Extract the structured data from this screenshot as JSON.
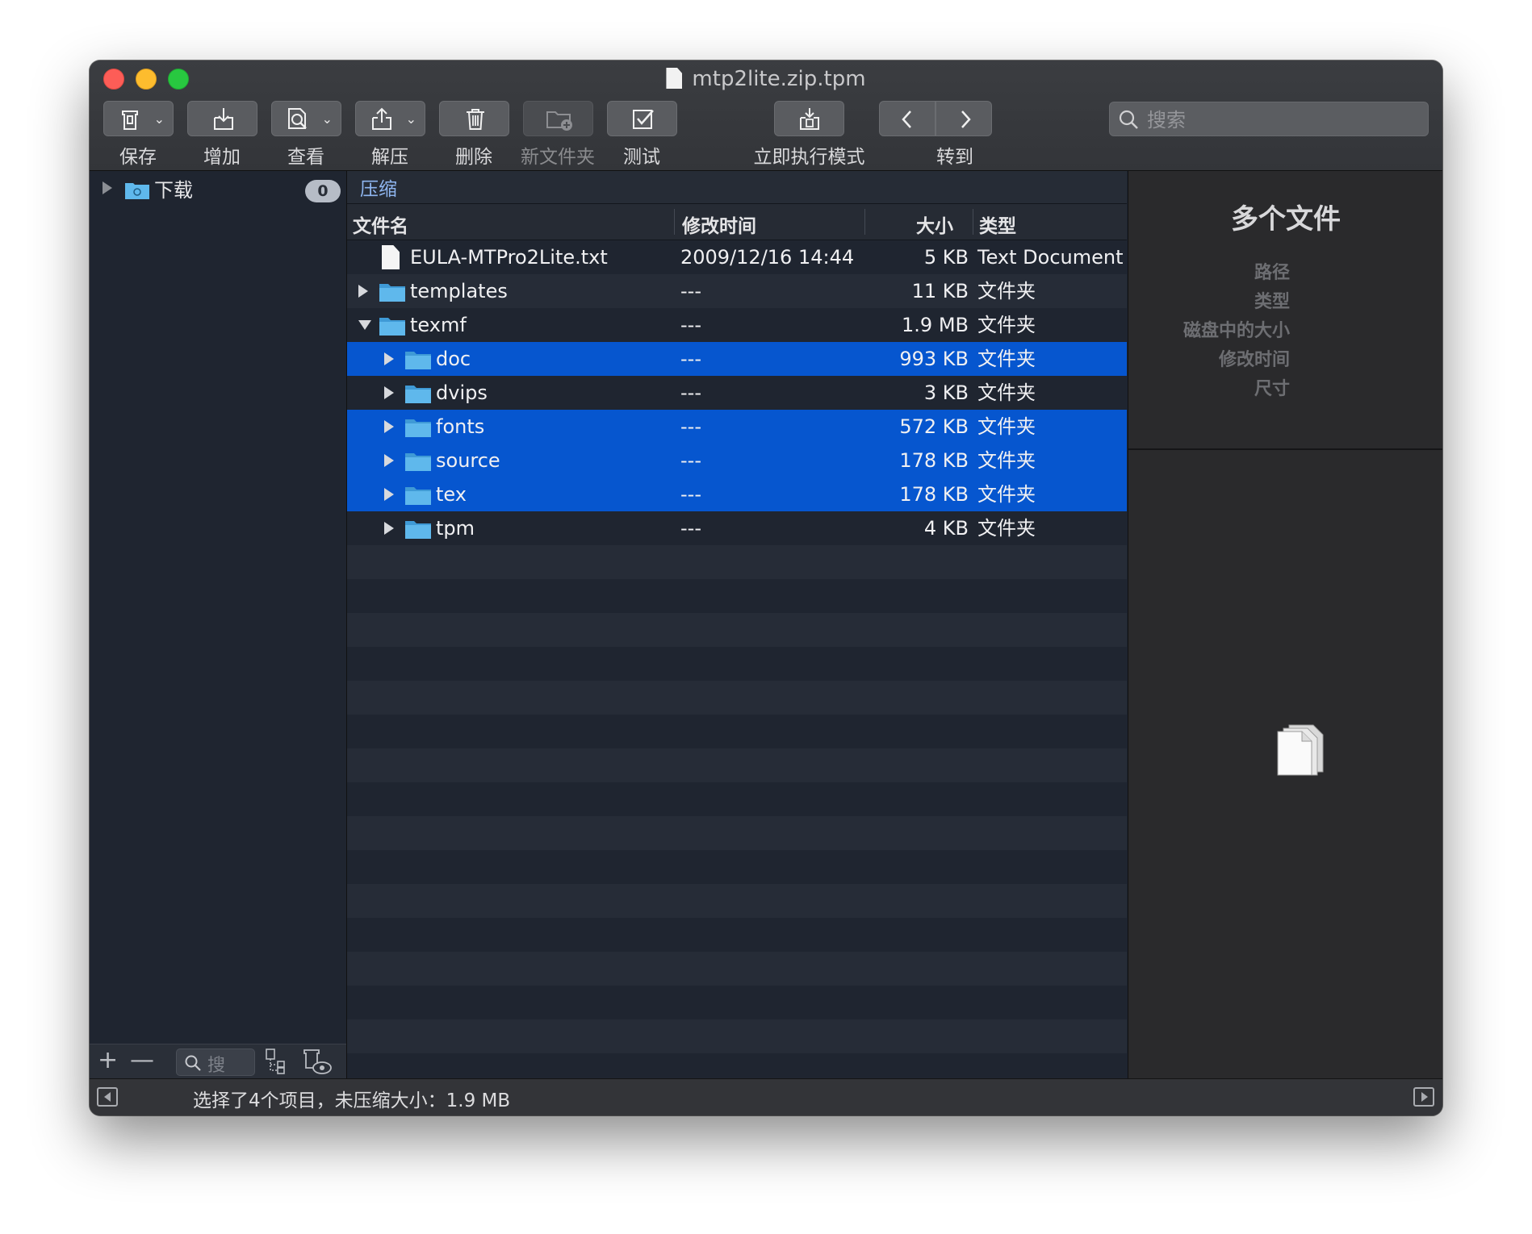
{
  "window": {
    "title": "mtp2lite.zip.tpm"
  },
  "toolbar": {
    "save": "保存",
    "add": "增加",
    "view": "查看",
    "extract": "解压",
    "delete": "删除",
    "new_folder": "新文件夹",
    "test": "测试",
    "instant_mode": "立即执行模式",
    "goto": "转到",
    "search_placeholder": "搜索"
  },
  "sidebar": {
    "items": [
      {
        "label": "下载",
        "badge": "0"
      }
    ],
    "search_placeholder": "搜"
  },
  "pathbar": {
    "label": "压缩"
  },
  "columns": {
    "name": "文件名",
    "modified": "修改时间",
    "size": "大小",
    "type": "类型"
  },
  "files": [
    {
      "name": "EULA-MTPro2Lite.txt",
      "date": "2009/12/16 14:44",
      "size": "5 KB",
      "type": "Text Document",
      "kind": "file",
      "level": 0,
      "selected": false
    },
    {
      "name": "templates",
      "date": "---",
      "size": "11 KB",
      "type": "文件夹",
      "kind": "folder",
      "level": 0,
      "expanded": false,
      "selected": false
    },
    {
      "name": "texmf",
      "date": "---",
      "size": "1.9 MB",
      "type": "文件夹",
      "kind": "folder",
      "level": 0,
      "expanded": true,
      "selected": false
    },
    {
      "name": "doc",
      "date": "---",
      "size": "993 KB",
      "type": "文件夹",
      "kind": "folder",
      "level": 1,
      "expanded": false,
      "selected": true
    },
    {
      "name": "dvips",
      "date": "---",
      "size": "3 KB",
      "type": "文件夹",
      "kind": "folder",
      "level": 1,
      "expanded": false,
      "selected": false
    },
    {
      "name": "fonts",
      "date": "---",
      "size": "572 KB",
      "type": "文件夹",
      "kind": "folder",
      "level": 1,
      "expanded": false,
      "selected": true
    },
    {
      "name": "source",
      "date": "---",
      "size": "178 KB",
      "type": "文件夹",
      "kind": "folder",
      "level": 1,
      "expanded": false,
      "selected": true
    },
    {
      "name": "tex",
      "date": "---",
      "size": "178 KB",
      "type": "文件夹",
      "kind": "folder",
      "level": 1,
      "expanded": false,
      "selected": true
    },
    {
      "name": "tpm",
      "date": "---",
      "size": "4 KB",
      "type": "文件夹",
      "kind": "folder",
      "level": 1,
      "expanded": false,
      "selected": false
    }
  ],
  "info": {
    "title": "多个文件",
    "fields": {
      "path": "路径",
      "type": "类型",
      "disk_size": "磁盘中的大小",
      "modified": "修改时间",
      "dimensions": "尺寸"
    }
  },
  "status": {
    "text": "选择了4个项目，未压缩大小：1.9 MB"
  },
  "colors": {
    "selection": "#0656cf",
    "folder": "#5fb8ec",
    "close": "#fd5d57",
    "minimize": "#fdbc2e",
    "zoom": "#28c840"
  },
  "icons": [
    "archive-save-icon",
    "add-icon",
    "view-icon",
    "extract-icon",
    "trash-icon",
    "new-folder-icon",
    "test-check-icon",
    "instant-mode-icon",
    "chevron-left-icon",
    "chevron-right-icon",
    "search-icon",
    "folder-icon",
    "document-icon",
    "multiple-documents-icon"
  ]
}
